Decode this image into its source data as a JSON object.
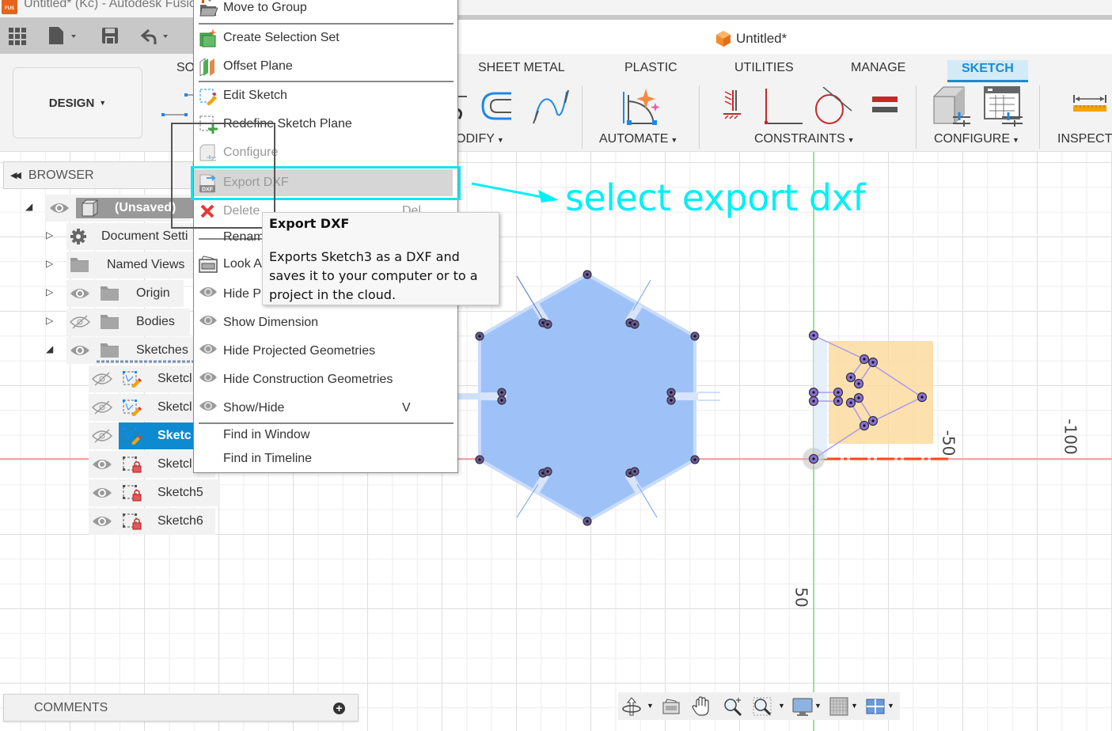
{
  "window": {
    "title": "Untitled* (Kc) - Autodesk Fusion",
    "app_icon_label": "FUS",
    "document_title": "Untitled*"
  },
  "quick_access": {
    "icons": [
      "app-grid-icon",
      "file-icon",
      "save-icon",
      "undo-icon"
    ]
  },
  "ribbon": {
    "workspace_button": "DESIGN",
    "tabs": [
      {
        "label": "SO",
        "active": false
      },
      {
        "label": "SHEET METAL",
        "active": false
      },
      {
        "label": "PLASTIC",
        "active": false
      },
      {
        "label": "UTILITIES",
        "active": false
      },
      {
        "label": "MANAGE",
        "active": false
      },
      {
        "label": "SKETCH",
        "active": true
      }
    ],
    "groups": [
      {
        "label": "ODIFY"
      },
      {
        "label": "AUTOMATE"
      },
      {
        "label": "CONSTRAINTS"
      },
      {
        "label": "CONFIGURE"
      },
      {
        "label": "INSPECT"
      }
    ]
  },
  "browser": {
    "header": "BROWSER",
    "items": [
      {
        "label": "(Unsaved)",
        "visible": true,
        "expanded": true
      },
      {
        "label": "Document Setti",
        "icon": "gear-icon",
        "expanded": false
      },
      {
        "label": "Named Views",
        "icon": "folder-icon",
        "expanded": false
      },
      {
        "label": "Origin",
        "visible": true,
        "icon": "folder-icon",
        "expanded": false
      },
      {
        "label": "Bodies",
        "visible": false,
        "icon": "folder-icon",
        "expanded": false
      },
      {
        "label": "Sketches",
        "visible": true,
        "icon": "folder-icon",
        "expanded": true
      },
      {
        "label": "Sketcl",
        "visible": false,
        "icon": "sketch-edit-icon"
      },
      {
        "label": "Sketcl",
        "visible": false,
        "icon": "sketch-edit-icon"
      },
      {
        "label": "Sketc",
        "visible": false,
        "icon": "sketch-edit-icon",
        "selected": true
      },
      {
        "label": "Sketcl",
        "visible": true,
        "icon": "sketch-locked-icon"
      },
      {
        "label": "Sketch5",
        "visible": true,
        "icon": "sketch-locked-icon"
      },
      {
        "label": "Sketch6",
        "visible": true,
        "icon": "sketch-locked-icon"
      }
    ]
  },
  "context_menu": {
    "items": [
      {
        "label": "Move to Group",
        "icon": "folder-move-icon"
      },
      {
        "label": "Create Selection Set",
        "icon": "selection-set-icon"
      },
      {
        "label": "Offset Plane",
        "icon": "offset-plane-icon"
      },
      {
        "label": "Edit Sketch",
        "icon": "edit-sketch-icon"
      },
      {
        "label": "Redefine Sketch Plane",
        "icon": "redefine-plane-icon"
      },
      {
        "label": "Configure",
        "icon": "configure-icon",
        "disabled": true
      },
      {
        "label": "Export DXF",
        "icon": "export-dxf-icon",
        "disabled": true,
        "hovered": true
      },
      {
        "label": "Delete",
        "icon": "delete-icon",
        "shortcut": "Del",
        "disabled": true
      },
      {
        "label": "Renam",
        "icon": ""
      },
      {
        "label": "Look A",
        "icon": "look-at-icon"
      },
      {
        "label": "Hide P",
        "icon": "eye-icon"
      },
      {
        "label": "Show Dimension",
        "icon": "eye-icon"
      },
      {
        "label": "Hide Projected Geometries",
        "icon": "eye-icon"
      },
      {
        "label": "Hide Construction Geometries",
        "icon": "eye-icon"
      },
      {
        "label": "Show/Hide",
        "icon": "eye-icon",
        "shortcut": "V"
      },
      {
        "label": "Find in Window",
        "icon": ""
      },
      {
        "label": "Find in Timeline",
        "icon": ""
      }
    ],
    "dxf_badge": "DXF"
  },
  "tooltip": {
    "title": "Export DXF",
    "body": "Exports Sketch3 as a DXF and saves it to your computer or to a project in the cloud."
  },
  "annotation": {
    "text": "select export dxf",
    "color": "#00f0f5"
  },
  "canvas": {
    "axis_labels": [
      "-50",
      "-100",
      "50"
    ]
  },
  "comments": {
    "label": "COMMENTS",
    "add_symbol": "+"
  },
  "nav_toolbar": {
    "buttons": [
      "orbit-icon",
      "look-at-icon",
      "pan-icon",
      "zoom-icon",
      "zoom-window-icon",
      "display-settings-icon",
      "grid-settings-icon",
      "viewports-icon"
    ]
  },
  "colors": {
    "accent": "#1a8bd1",
    "selected_row": "#0e8ad1",
    "highlight": "#19e1ec",
    "sketch_fill": "#8fb8f7",
    "profile_fill": "#f9d69a",
    "x_axis": "#e55a5a",
    "y_axis": "#6fd36f"
  }
}
